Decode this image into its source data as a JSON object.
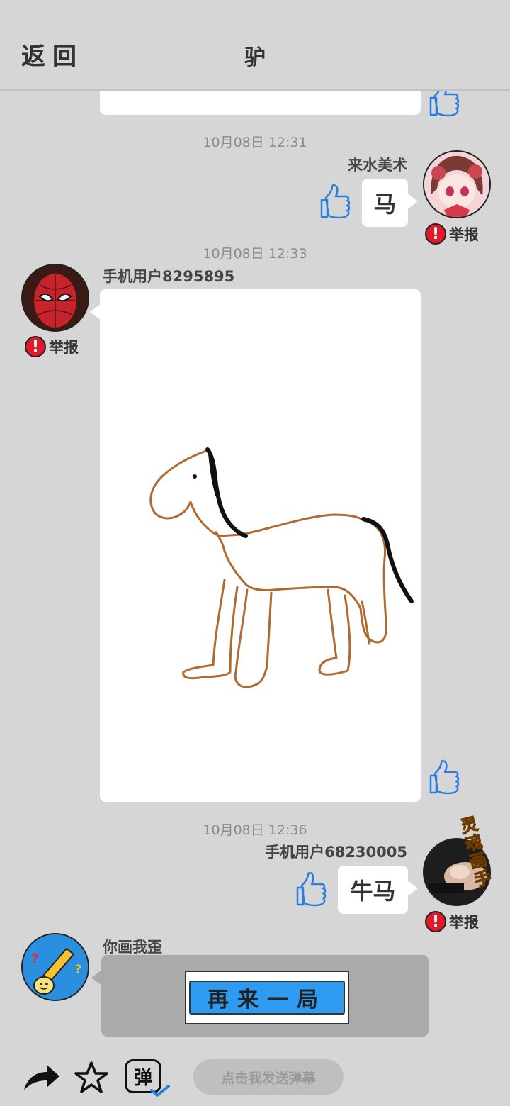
{
  "header": {
    "back_label": "返回",
    "title": "驴"
  },
  "messages": [
    {
      "time": "10月08日 12:31",
      "user": "来水美术",
      "text": "马",
      "report": "举报"
    },
    {
      "time": "10月08日 12:33",
      "user": "手机用户8295895",
      "report": "举报"
    },
    {
      "time": "10月08日 12:36",
      "user": "手机用户68230005",
      "text": "牛马",
      "report": "举报",
      "badge": "灵魂画手"
    }
  ],
  "game": {
    "name": "你画我歪",
    "button_label": "再来一局"
  },
  "toolbar": {
    "danmu_placeholder": "点击我发送弹幕",
    "danmu_icon_label": "弹"
  },
  "colors": {
    "background": "#d6d6d6",
    "thumb": "#2a7de1",
    "report": "#e2192b",
    "button": "#2e9bf2",
    "drawing": "#b06a30"
  }
}
